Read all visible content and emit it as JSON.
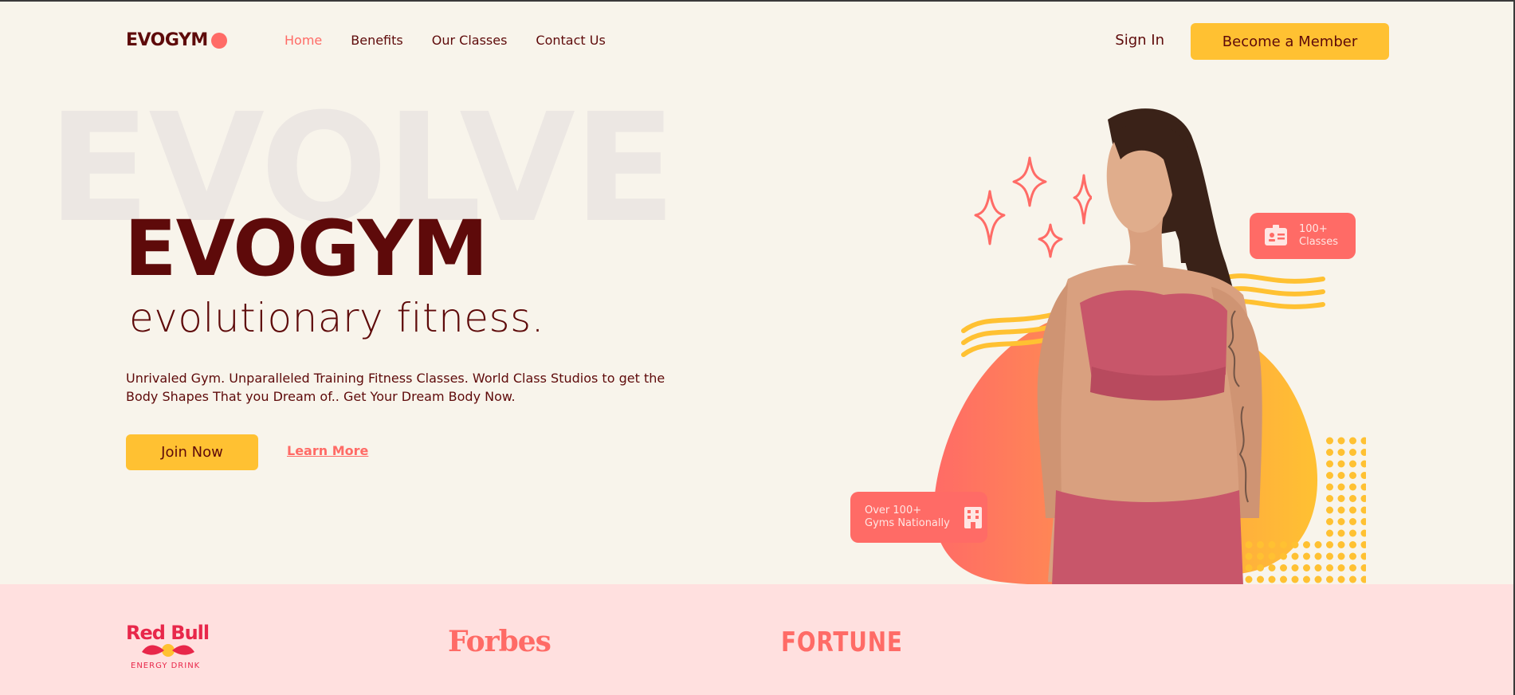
{
  "nav": {
    "logo": "EVOGYM",
    "links": [
      "Home",
      "Benefits",
      "Our Classes",
      "Contact Us"
    ],
    "sign_in": "Sign In",
    "cta": "Become a Member"
  },
  "hero": {
    "background_word": "EVOLVE",
    "title": "EVOGYM",
    "subtitle": "evolutionary fitness.",
    "description": "Unrivaled Gym. Unparalleled Training Fitness Classes. World Class Studios to get the Body Shapes That you Dream of.. Get Your Dream Body Now.",
    "join_button": "Join Now",
    "learn_more": "Learn More"
  },
  "badges": {
    "classes_line1": "100+",
    "classes_line2": "Classes",
    "gyms_line1": "Over 100+",
    "gyms_line2": "Gyms Nationally"
  },
  "sponsors": {
    "redbull": "Red Bull",
    "redbull_sub": "ENERGY DRINK",
    "forbes": "Forbes",
    "fortune": "FORTUNE"
  },
  "colors": {
    "background": "#f8f4eb",
    "primary_dark": "#5e0a0a",
    "accent_coral": "#ff6b66",
    "accent_yellow": "#ffc132",
    "sponsor_band": "#ffe0df"
  },
  "icons": {
    "classes_badge": "id-card-icon",
    "gyms_badge": "building-icon"
  }
}
